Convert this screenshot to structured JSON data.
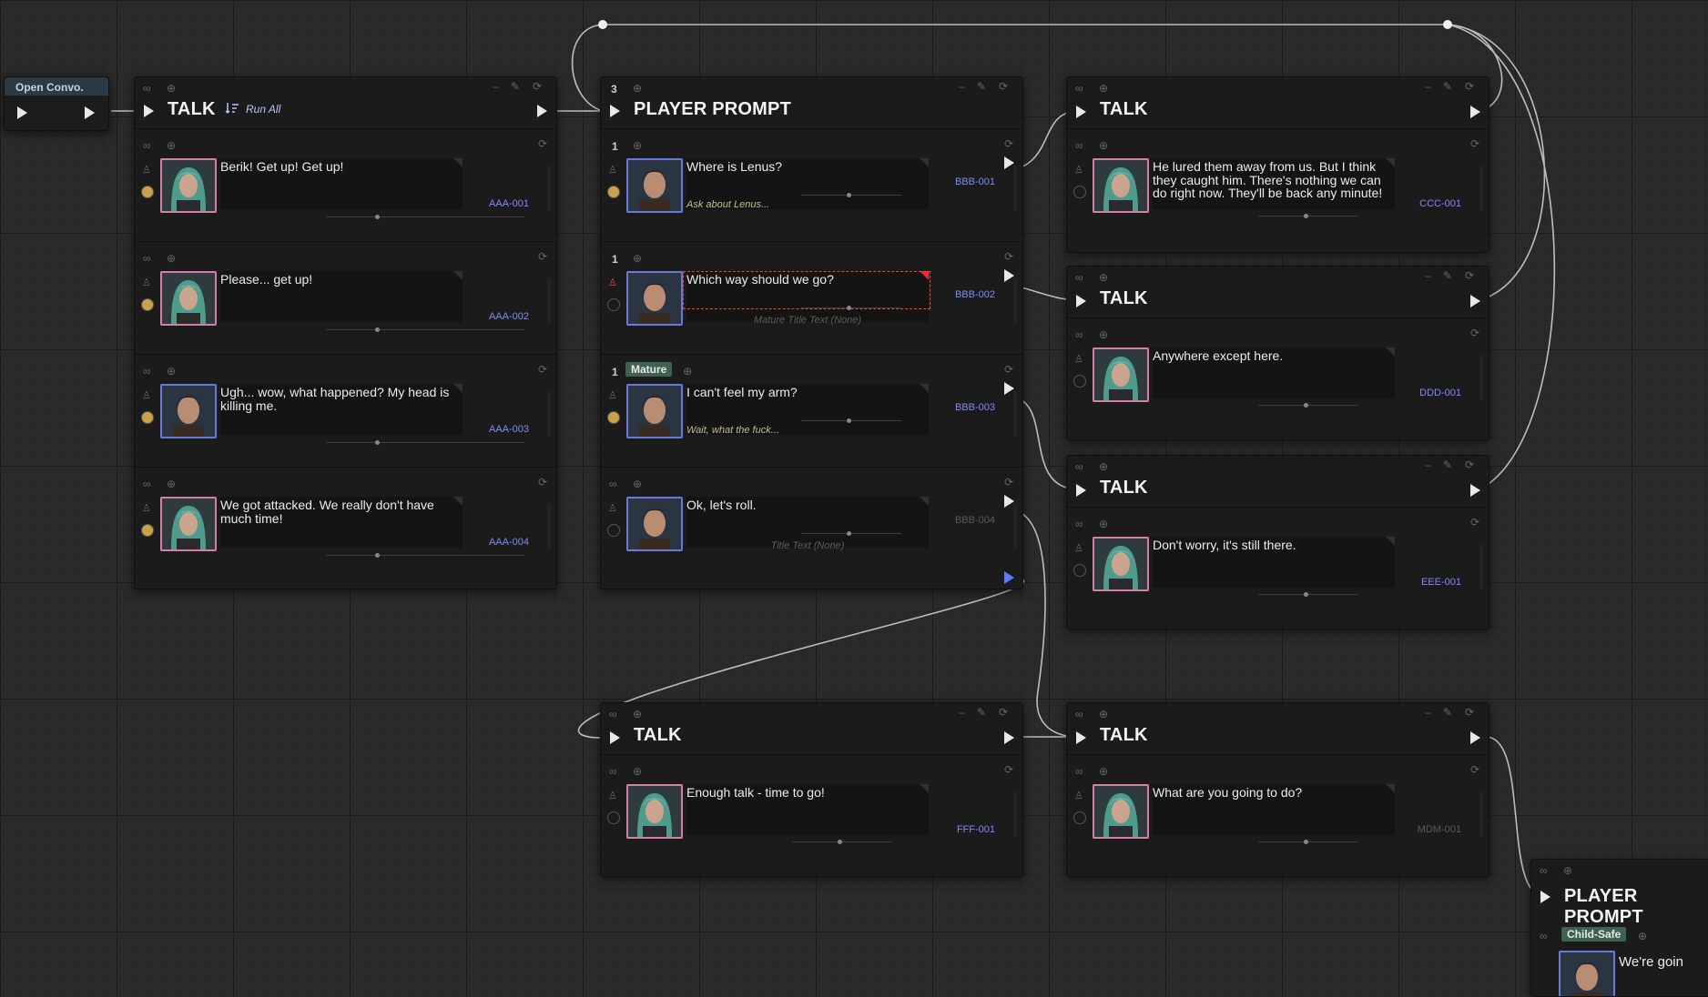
{
  "open_convo": {
    "label": "Open Convo."
  },
  "talk_label": "TALK",
  "run_all": "Run All",
  "prompt_label": "PLAYER PROMPT",
  "prompt_index": "3",
  "talk_node_a": {
    "rows": [
      {
        "text": "Berik! Get up! Get up!",
        "id": "AAA-001",
        "speaker": "girl"
      },
      {
        "text": "Please... get up!",
        "id": "AAA-002",
        "speaker": "girl"
      },
      {
        "text": "Ugh... wow, what happened? My head is killing me.",
        "id": "AAA-003",
        "speaker": "man"
      },
      {
        "text": "We got attacked. We really don't have much time!",
        "id": "AAA-004",
        "speaker": "girl"
      }
    ]
  },
  "prompt_node": {
    "rows": [
      {
        "idx": "1",
        "text": "Where is Lenus?",
        "id": "BBB-001",
        "menu": "Ask about Lenus...",
        "badge": ""
      },
      {
        "idx": "1",
        "text": "Which way should we go?",
        "id": "BBB-002",
        "title_none": "Mature Title Text (None)",
        "badge": ""
      },
      {
        "idx": "1",
        "text": "I can't feel my arm?",
        "id": "BBB-003",
        "menu": "Wait, what the fuck...",
        "badge": "Mature"
      },
      {
        "idx": "",
        "text": "Ok, let's roll.",
        "id": "BBB-004",
        "title_none": "Title Text (None)",
        "badge": ""
      }
    ]
  },
  "talk_ccc": {
    "text": "He lured them away from us. But I think they caught him. There's nothing we can do right now. They'll be back any minute!",
    "id": "CCC-001"
  },
  "talk_ddd": {
    "text": "Anywhere except here.",
    "id": "DDD-001"
  },
  "talk_eee": {
    "text": "Don't worry, it's still there.",
    "id": "EEE-001"
  },
  "talk_fff": {
    "text": "Enough talk - time to go!",
    "id": "FFF-001"
  },
  "talk_mdm": {
    "text": "What are you going to do?",
    "id": "MDM-001"
  },
  "prompt_bottom": {
    "badge": "Child-Safe",
    "text": "We're goin"
  },
  "colors": {
    "background": "#2a2a2a",
    "node": "#1b1b1b",
    "id_text": "#7d8bf2",
    "selected": "#ff3a3a",
    "mature_badge": "#3e6150",
    "exec_pin": "#e8e8e8"
  }
}
